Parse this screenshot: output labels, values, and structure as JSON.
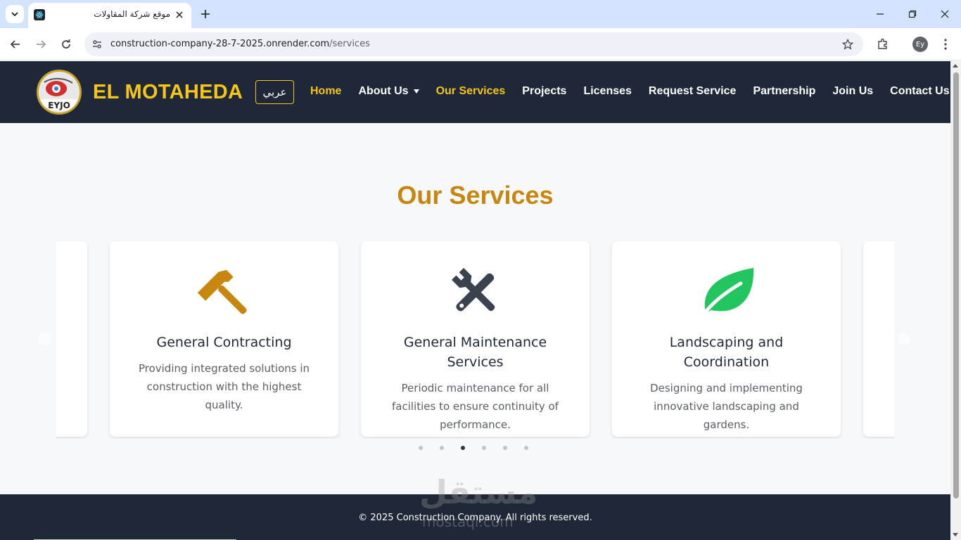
{
  "browser": {
    "tab_title": "موقع شركة المقاولات",
    "url_host": "construction-company-28-7-2025.onrender.com",
    "url_path": "/services",
    "profile_initials": "Ey"
  },
  "site": {
    "logo_text": "EYJO",
    "brand": "EL MOTAHEDA",
    "lang_button": "عربي",
    "menu": [
      {
        "label": "Home",
        "active": false
      },
      {
        "label": "About Us",
        "has_dropdown": true
      },
      {
        "label": "Our Services",
        "active": true
      },
      {
        "label": "Projects"
      },
      {
        "label": "Licenses"
      },
      {
        "label": "Request Service"
      },
      {
        "label": "Partnership"
      },
      {
        "label": "Join Us"
      },
      {
        "label": "Contact Us"
      }
    ]
  },
  "services": {
    "title": "Our Services",
    "cards": [
      {
        "icon": "hammer-icon",
        "icon_color": "#c8860d",
        "title": "General Contracting",
        "description": "Providing integrated solutions in construction with the highest quality."
      },
      {
        "icon": "tools-icon",
        "icon_color": "#3a4250",
        "title": "General Maintenance Services",
        "description": "Periodic maintenance for all facilities to ensure continuity of performance."
      },
      {
        "icon": "leaf-icon",
        "icon_color": "#22c55e",
        "title": "Landscaping and Coordination",
        "description": "Designing and implementing innovative landscaping and gardens."
      }
    ],
    "pagination": {
      "count": 6,
      "active_index": 2
    }
  },
  "footer": {
    "copyright": "© 2025 Construction Company. All rights reserved.",
    "watermark": "مستقل",
    "watermark_sub": "mostaql.com"
  },
  "colors": {
    "nav_bg": "#1e2838",
    "accent": "#f5c518",
    "title": "#c8860d"
  }
}
